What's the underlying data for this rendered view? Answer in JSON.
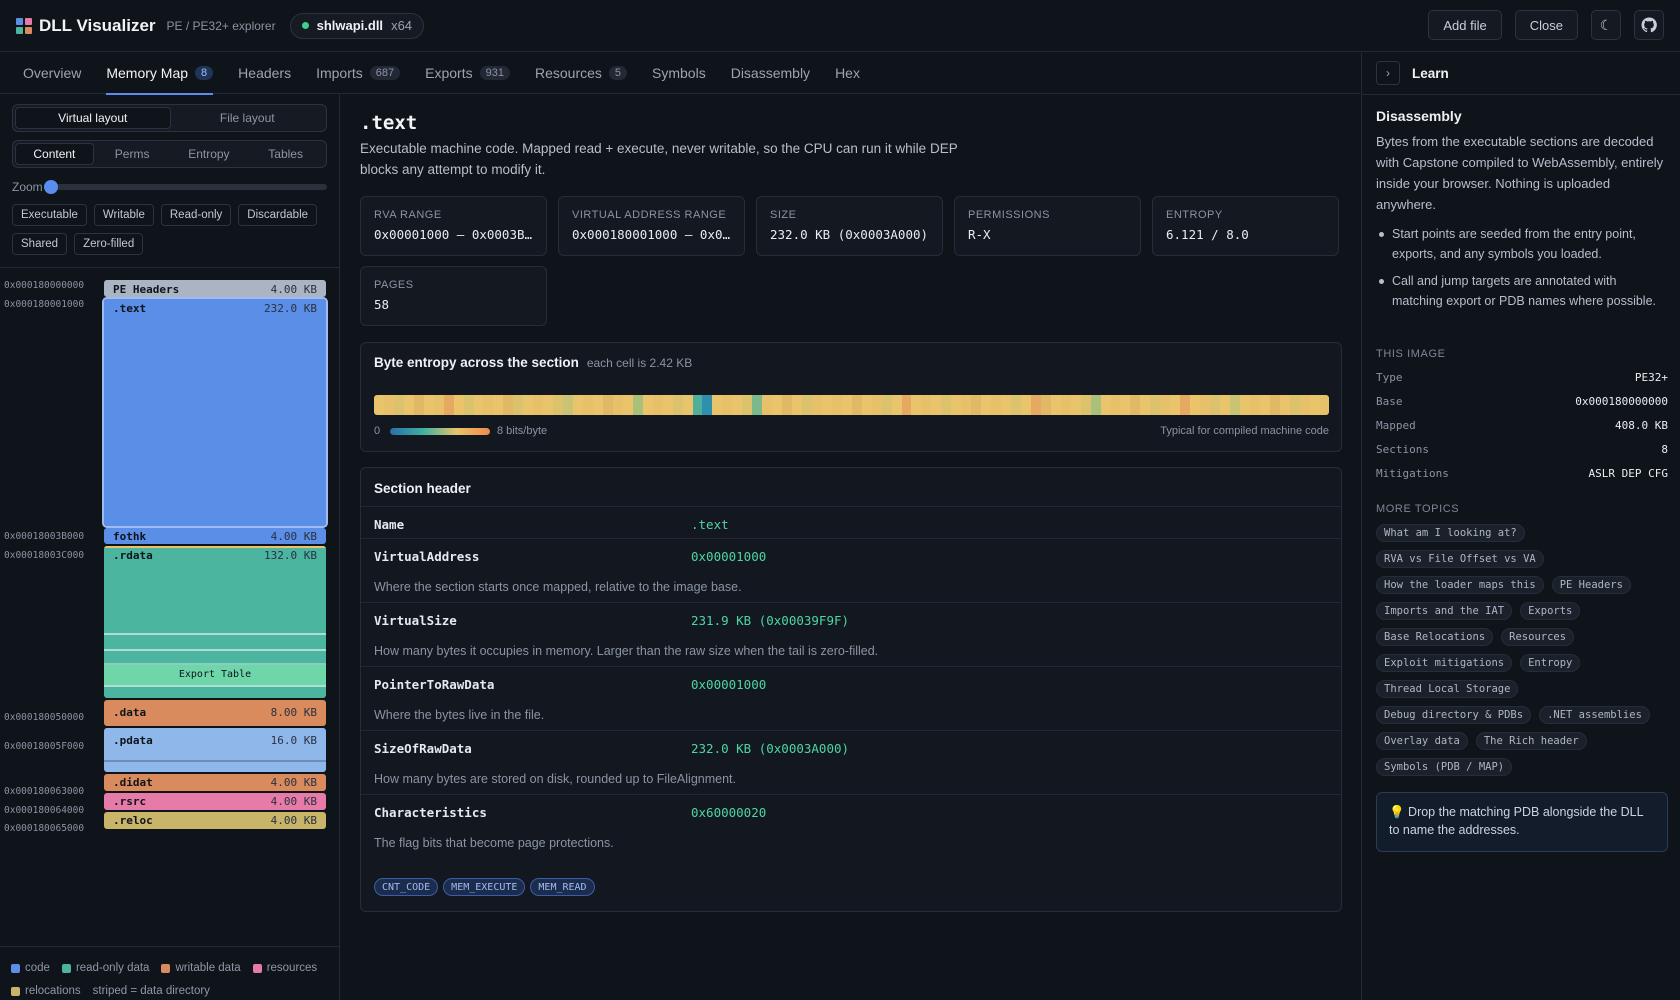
{
  "header": {
    "app_title": "DLL Visualizer",
    "app_subtitle": "PE / PE32+ explorer",
    "file_name": "shlwapi.dll",
    "arch": "x64",
    "buttons": {
      "add_file": "Add file",
      "close": "Close",
      "theme_icon": "moon-icon",
      "github_icon": "github-icon"
    }
  },
  "tabs": [
    {
      "label": "Overview",
      "count": null
    },
    {
      "label": "Memory Map",
      "count": "8",
      "active": true
    },
    {
      "label": "Headers",
      "count": null
    },
    {
      "label": "Imports",
      "count": "687"
    },
    {
      "label": "Exports",
      "count": "931"
    },
    {
      "label": "Resources",
      "count": "5"
    },
    {
      "label": "Symbols",
      "count": null
    },
    {
      "label": "Disassembly",
      "count": null
    },
    {
      "label": "Hex",
      "count": null
    }
  ],
  "left": {
    "layout_toggle": [
      "Virtual layout",
      "File layout"
    ],
    "color_modes": [
      "Content",
      "Perms",
      "Entropy",
      "Tables"
    ],
    "zoom_label": "Zoom",
    "zoom_level": 0,
    "filters": [
      "Executable",
      "Writable",
      "Read-only",
      "Discardable",
      "Shared",
      "Zero-filled"
    ],
    "addresses": [
      "0x000180000000",
      "0x000180001000",
      "0x00018003B000",
      "0x00018003C000",
      "0x000180050000",
      "0x00018005F000",
      "0x000180063000",
      "0x000180064000",
      "0x000180065000"
    ],
    "sections": [
      {
        "name": "PE Headers",
        "size": "4.00 KB",
        "color": "#aab4c2"
      },
      {
        "name": ".text",
        "size": "232.0 KB",
        "color": "#5b8ee6"
      },
      {
        "name": "fothk",
        "size": "4.00 KB",
        "color": "#5b8ee6"
      },
      {
        "name": ".rdata",
        "size": "132.0 KB",
        "color": "#4bb5a0"
      },
      {
        "name": ".data",
        "size": "8.00 KB",
        "color": "#d98b5e"
      },
      {
        "name": ".pdata",
        "size": "16.0 KB",
        "color": "#8fb7ea"
      },
      {
        "name": ".didat",
        "size": "4.00 KB",
        "color": "#d98b5e"
      },
      {
        "name": ".rsrc",
        "size": "4.00 KB",
        "color": "#e67aa8"
      },
      {
        "name": ".reloc",
        "size": "4.00 KB",
        "color": "#c9b56a"
      }
    ],
    "export_table_label": "Export Table",
    "legend": [
      {
        "label": "code",
        "color": "#5b8ee6"
      },
      {
        "label": "read-only data",
        "color": "#4bb5a0"
      },
      {
        "label": "writable data",
        "color": "#d98b5e"
      },
      {
        "label": "resources",
        "color": "#e67aa8"
      },
      {
        "label": "relocations",
        "color": "#c9b56a"
      }
    ],
    "legend_note": "striped = data directory"
  },
  "main": {
    "title": ".text",
    "description": "Executable machine code. Mapped read + execute, never writable, so the CPU can run it while DEP blocks any attempt to modify it.",
    "stats": [
      {
        "key": "RVA RANGE",
        "value": "0x00001000 – 0x0003B…"
      },
      {
        "key": "VIRTUAL ADDRESS RANGE",
        "value": "0x000180001000 – 0x0…"
      },
      {
        "key": "SIZE",
        "value": "232.0 KB (0x0003A000)"
      },
      {
        "key": "PERMISSIONS",
        "value": "R-X"
      },
      {
        "key": "ENTROPY",
        "value": "6.121 / 8.0"
      },
      {
        "key": "PAGES",
        "value": "58"
      }
    ],
    "entropy": {
      "title": "Byte entropy across the section",
      "hint": "each cell is 2.42 KB",
      "scale_min": "0",
      "scale_max": "8 bits/byte",
      "note": "Typical for compiled machine code"
    },
    "section_header": {
      "title": "Section header",
      "rows": [
        {
          "key": "Name",
          "value": ".text",
          "desc": ""
        },
        {
          "key": "VirtualAddress",
          "value": "0x00001000",
          "desc": "Where the section starts once mapped, relative to the image base."
        },
        {
          "key": "VirtualSize",
          "value": "231.9 KB (0x00039F9F)",
          "desc": "How many bytes it occupies in memory. Larger than the raw size when the tail is zero-filled."
        },
        {
          "key": "PointerToRawData",
          "value": "0x00001000",
          "desc": "Where the bytes live in the file."
        },
        {
          "key": "SizeOfRawData",
          "value": "232.0 KB (0x0003A000)",
          "desc": "How many bytes are stored on disk, rounded up to FileAlignment."
        },
        {
          "key": "Characteristics",
          "value": "0x60000020",
          "desc": "The flag bits that become page protections."
        }
      ],
      "flags": [
        "CNT_CODE",
        "MEM_EXECUTE",
        "MEM_READ"
      ]
    }
  },
  "learn": {
    "title": "Learn",
    "heading": "Disassembly",
    "paragraph": "Bytes from the executable sections are decoded with Capstone compiled to WebAssembly, entirely inside your browser. Nothing is uploaded anywhere.",
    "bullets": [
      "Start points are seeded from the entry point, exports, and any symbols you loaded.",
      "Call and jump targets are annotated with matching export or PDB names where possible."
    ],
    "image_caption": "THIS IMAGE",
    "image_info": [
      {
        "key": "Type",
        "value": "PE32+"
      },
      {
        "key": "Base",
        "value": "0x000180000000"
      },
      {
        "key": "Mapped",
        "value": "408.0 KB"
      },
      {
        "key": "Sections",
        "value": "8"
      },
      {
        "key": "Mitigations",
        "value": "ASLR DEP CFG"
      }
    ],
    "topics_caption": "MORE TOPICS",
    "topics": [
      "What am I looking at?",
      "RVA vs File Offset vs VA",
      "How the loader maps this",
      "PE Headers",
      "Imports and the IAT",
      "Exports",
      "Base Relocations",
      "Resources",
      "Exploit mitigations",
      "Entropy",
      "Thread Local Storage",
      "Debug directory & PDBs",
      ".NET assemblies",
      "Overlay data",
      "The Rich header",
      "Symbols (PDB / MAP)"
    ],
    "tip": "💡 Drop the matching PDB alongside the DLL to name the addresses."
  }
}
